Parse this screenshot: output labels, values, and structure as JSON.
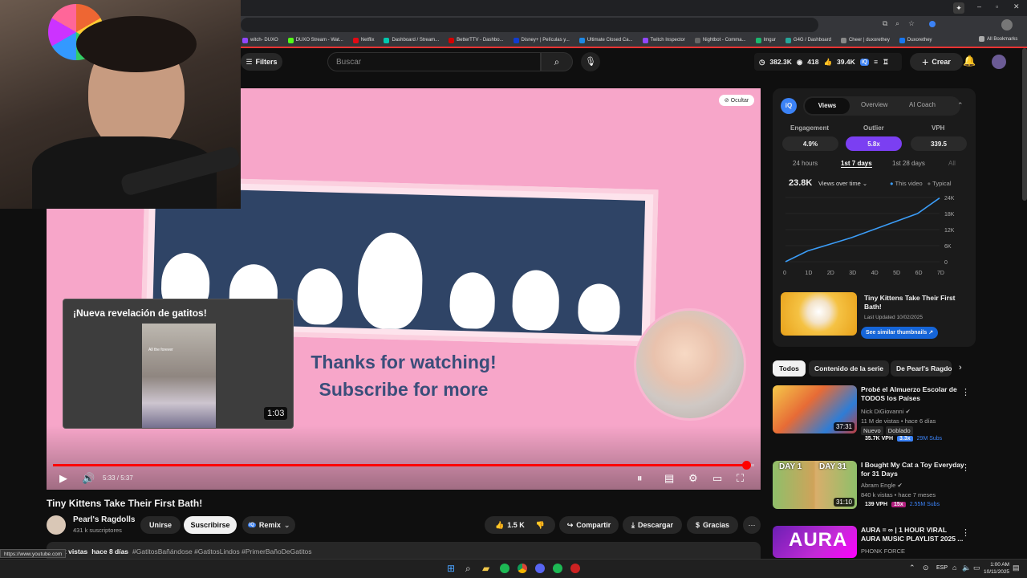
{
  "browser": {
    "bookmarks": [
      "witch- DUXO",
      "DUXO Stream - Wat...",
      "Netflix",
      "Dashboard / Stream...",
      "BetterTTV - Dashbo...",
      "Disney+ | Películas y...",
      "Ultimate Closed Ca...",
      "Twitch Inspector",
      "Nightbot - Comma...",
      "Imgur",
      "G4G / Dashboard",
      "Cheer | duxorethey",
      "Duxorethey",
      "All Bookmarks"
    ],
    "status_url": "https://www.youtube.com"
  },
  "header": {
    "filters": "Filters",
    "search_placeholder": "Buscar",
    "stats": {
      "views": "382.3K",
      "watch": "418",
      "likes": "39.4K"
    },
    "create": "Crear"
  },
  "player": {
    "hide_label": "Ocultar",
    "end_text_1": "Thanks for watching!",
    "end_text_2": "Subscribe for more",
    "time": "5:33 / 5:37",
    "progress": 0.988,
    "endcard": {
      "title": "¡Nueva revelación de gatitos!",
      "duration": "1:03",
      "inner_caption": "All the forever"
    }
  },
  "video": {
    "title": "Tiny Kittens Take Their First Bath!",
    "channel": "Pearl's Ragdolls",
    "subs": "431 k suscriptores",
    "join": "Unirse",
    "subscribe": "Suscribirse",
    "remix": "Remix",
    "likes": "1.5 K",
    "share": "Compartir",
    "download": "Descargar",
    "thanks": "Gracias",
    "desc_views": "k vistas",
    "desc_date": "hace 8 días",
    "desc_tags": "#GatitosBañándose #GatitosLindos #PrimerBañoDeGatitos"
  },
  "vidiq": {
    "tabs": [
      "Views",
      "Overview",
      "AI Coach"
    ],
    "metric_labels": [
      "Engagement",
      "Outlier",
      "VPH"
    ],
    "metric_values": [
      "4.9%",
      "5.8x",
      "339.5"
    ],
    "ranges": [
      "24 hours",
      "1st 7 days",
      "1st 28 days",
      "All"
    ],
    "total": "23.8K",
    "dropdown": "Views over time",
    "legend": [
      "This video",
      "Typical"
    ],
    "card_title": "Tiny Kittens Take Their First Bath!",
    "card_updated": "Last Updated 10/02/2025",
    "card_button": "See similar thumbnails",
    "accent": "#7b3ff2"
  },
  "chart_data": {
    "type": "line",
    "x": [
      "0",
      "1D",
      "2D",
      "3D",
      "4D",
      "5D",
      "6D",
      "7D"
    ],
    "series": [
      {
        "values": [
          0,
          4,
          6.5,
          9,
          12,
          15,
          18,
          23.8
        ]
      }
    ],
    "yticks": [
      "24K",
      "18K",
      "12K",
      "6K",
      "0"
    ],
    "ylim": [
      0,
      24
    ]
  },
  "chips": [
    "Todos",
    "Contenido de la serie",
    "De Pearl's Ragdo"
  ],
  "recs": [
    {
      "title": "Probé el Almuerzo Escolar de TODOS los Países",
      "channel": "Nick DiGiovanni",
      "meta": "11 M de vistas • hace 6 días",
      "badges": [
        "Nuevo",
        "Doblado"
      ],
      "stats": [
        "35.7K VPH",
        "3.3x",
        "29M Subs"
      ],
      "duration": "37:31"
    },
    {
      "title": "I Bought My Cat a Toy Everyday for 31 Days",
      "channel": "Abram Engle",
      "meta": "840 k vistas • hace 7 meses",
      "badges": [],
      "stats": [
        "139 VPH",
        "15x",
        "2.55M Subs"
      ],
      "duration": "31:10",
      "thumb_text": [
        "DAY 1",
        "DAY 31"
      ]
    },
    {
      "title": "AURA = ∞ | 1 HOUR VIRAL AURA MUSIC PLAYLIST 2025 ...",
      "channel": "PHONK FORCE",
      "meta": "",
      "badges": [],
      "stats": [],
      "duration": "",
      "thumb_text": [
        "AURA"
      ]
    }
  ],
  "taskbar": {
    "lang": "ESP",
    "time": "1:00 AM",
    "date": "10/11/2025"
  }
}
